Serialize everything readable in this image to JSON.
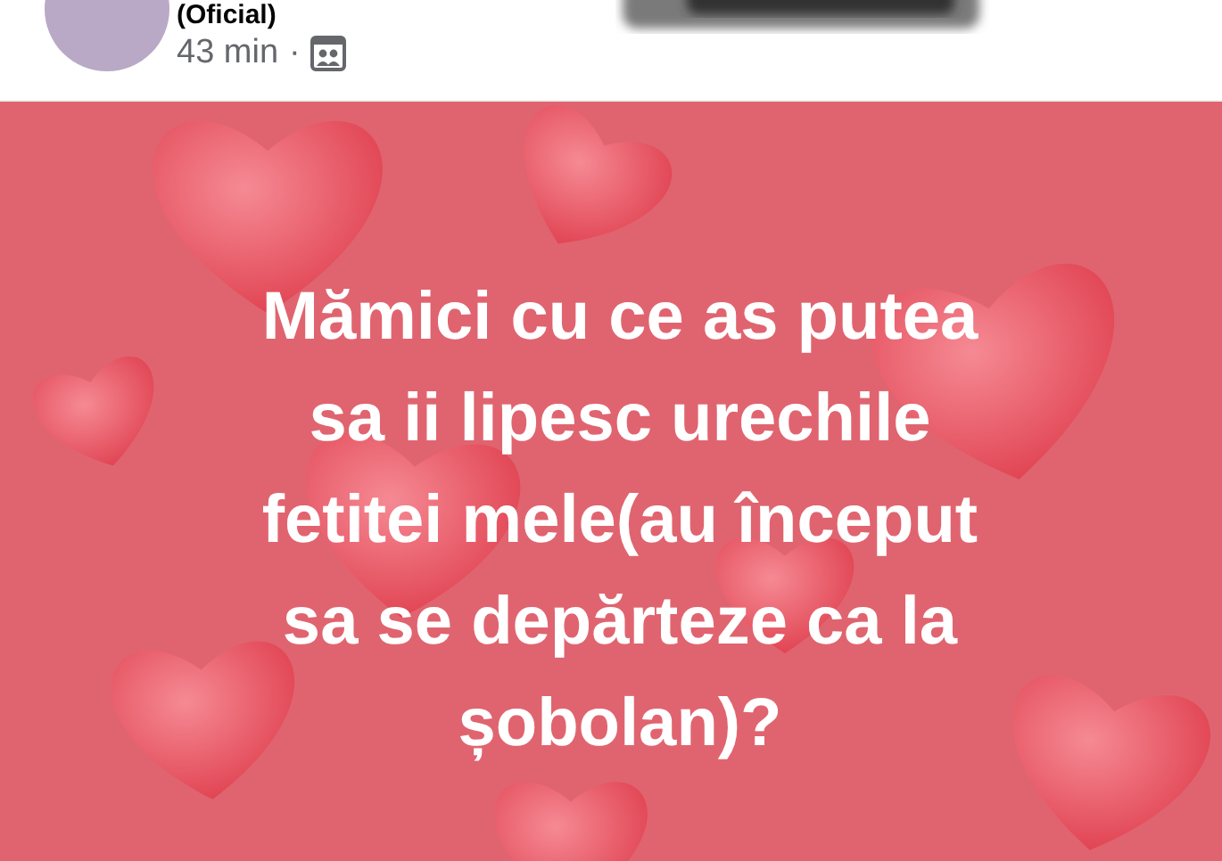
{
  "post": {
    "author": "(Oficial)",
    "time": "43 min",
    "separator": "·"
  },
  "image": {
    "kind": "picture",
    "text_lines": [
      "Mămici cu ce as putea",
      "sa ii lipesc urechile",
      "fetitei mele(au început",
      "sa se depărteze ca la",
      "șobolan)?"
    ]
  }
}
